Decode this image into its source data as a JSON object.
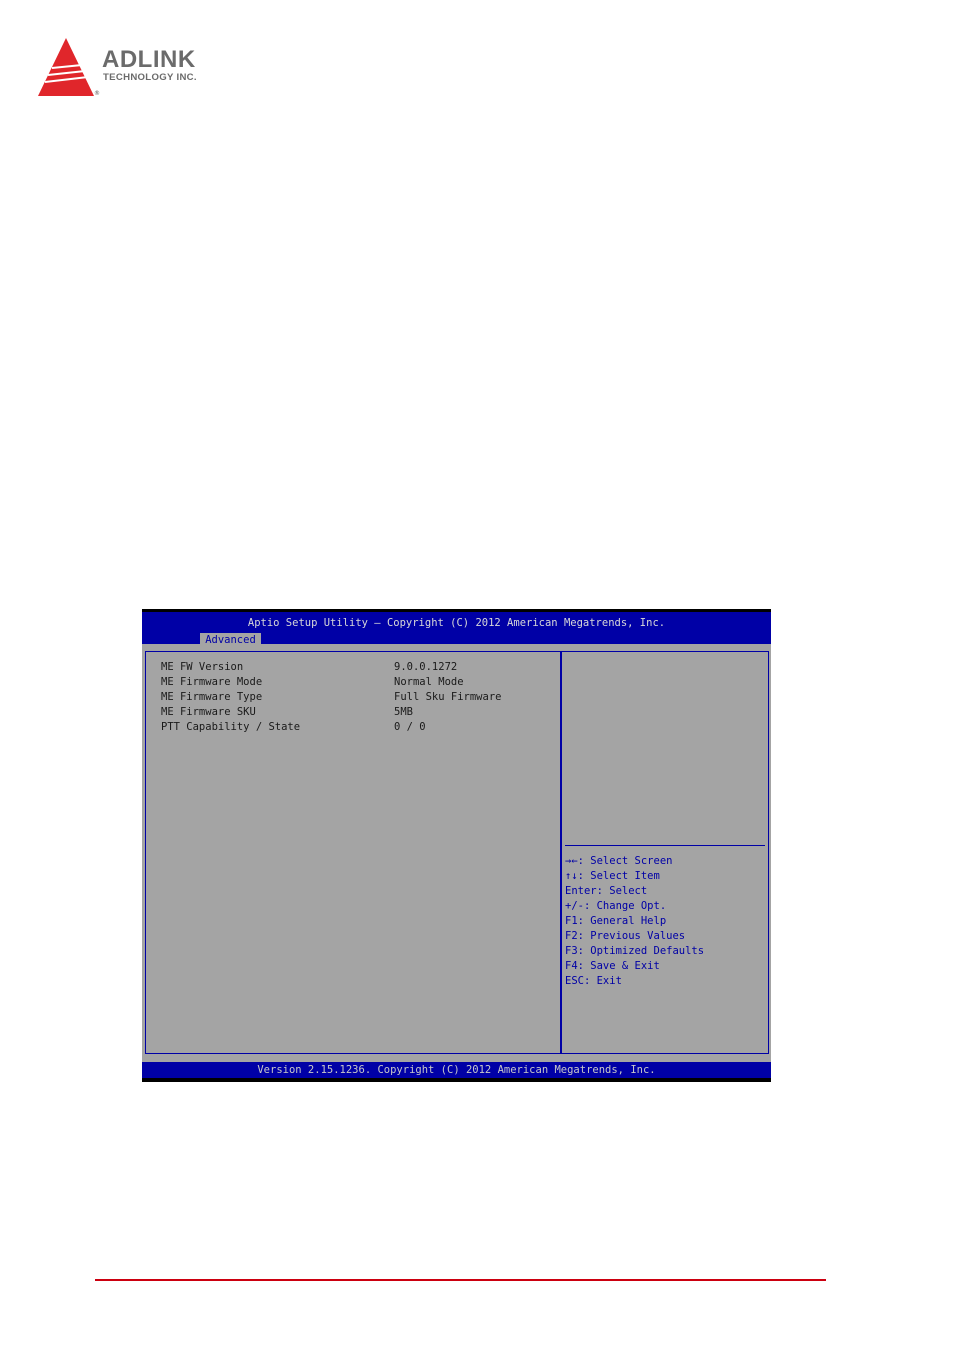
{
  "brand": {
    "name": "ADLINK",
    "subtitle": "TECHNOLOGY INC.",
    "registered": "®",
    "color": "#e0262b"
  },
  "bios": {
    "title": "Aptio Setup Utility – Copyright (C) 2012 American Megatrends, Inc.",
    "active_tab": "Advanced",
    "items": [
      {
        "label": "ME FW Version",
        "value": "9.0.0.1272"
      },
      {
        "label": "ME Firmware Mode",
        "value": "Normal Mode"
      },
      {
        "label": "ME Firmware Type",
        "value": "Full Sku Firmware"
      },
      {
        "label": "ME Firmware SKU",
        "value": "5MB"
      },
      {
        "label": "PTT Capability / State",
        "value": "0 / 0"
      }
    ],
    "help": [
      "→←: Select Screen",
      "↑↓: Select Item",
      "Enter: Select",
      "+/-: Change Opt.",
      "F1: General Help",
      "F2: Previous Values",
      "F3: Optimized Defaults",
      "F4: Save & Exit",
      "ESC: Exit"
    ],
    "footer": "Version 2.15.1236. Copyright (C) 2012 American Megatrends, Inc.",
    "colors": {
      "header": "#0000a6",
      "body": "#a4a4a4",
      "help_text": "#0000a6"
    }
  }
}
